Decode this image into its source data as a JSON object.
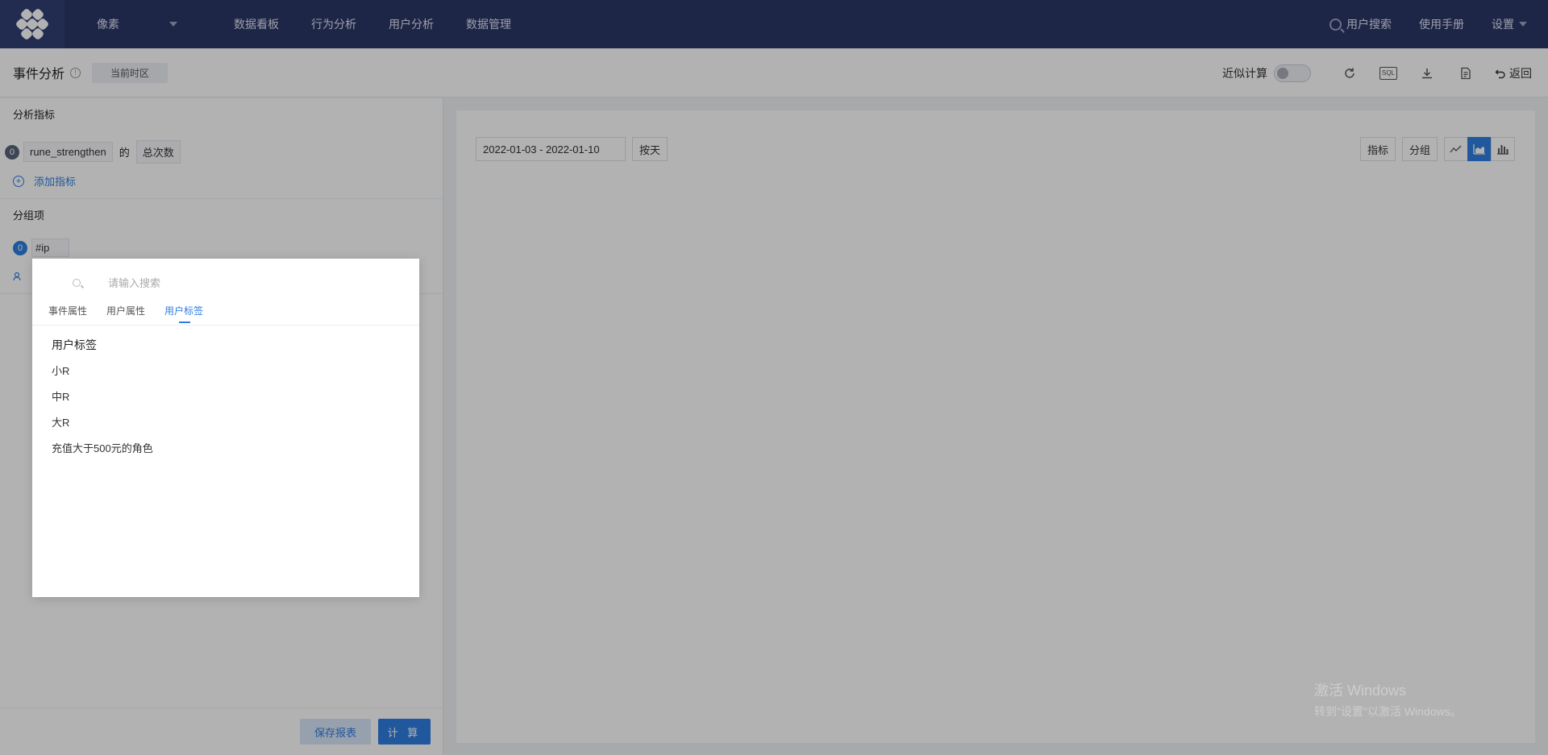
{
  "topnav": {
    "project": "像素",
    "links": [
      "数据看板",
      "行为分析",
      "用户分析",
      "数据管理"
    ],
    "user_search": "用户搜索",
    "manual": "使用手册",
    "settings": "设置"
  },
  "header": {
    "title": "事件分析",
    "timezone": "当前时区",
    "approx_label": "近似计算",
    "sql_label": "SQL",
    "back_label": "返回"
  },
  "left": {
    "metrics_title": "分析指标",
    "metric": {
      "index": "0",
      "event": "rune_strengthen",
      "connector": "的",
      "measure": "总次数"
    },
    "add_metric": "添加指标",
    "group_title": "分组项",
    "group": {
      "index": "0",
      "field": "#ip"
    },
    "save_label": "保存报表",
    "calc_label": "计 算"
  },
  "right": {
    "date_range": "2022-01-03 - 2022-01-10",
    "granularity": "按天",
    "metric_btn": "指标",
    "group_btn": "分组",
    "active_chart": "area"
  },
  "popup": {
    "search_placeholder": "请输入搜索",
    "tabs": [
      "事件属性",
      "用户属性",
      "用户标签"
    ],
    "active_tab": "用户标签",
    "list_title": "用户标签",
    "items": [
      "小R",
      "中R",
      "大R",
      "充值大于500元的角色"
    ]
  },
  "watermark": {
    "line1": "激活 Windows",
    "line2": "转到\"设置\"以激活 Windows。"
  },
  "colors": {
    "nav_bg": "#2b3768",
    "accent": "#2f7de1"
  }
}
